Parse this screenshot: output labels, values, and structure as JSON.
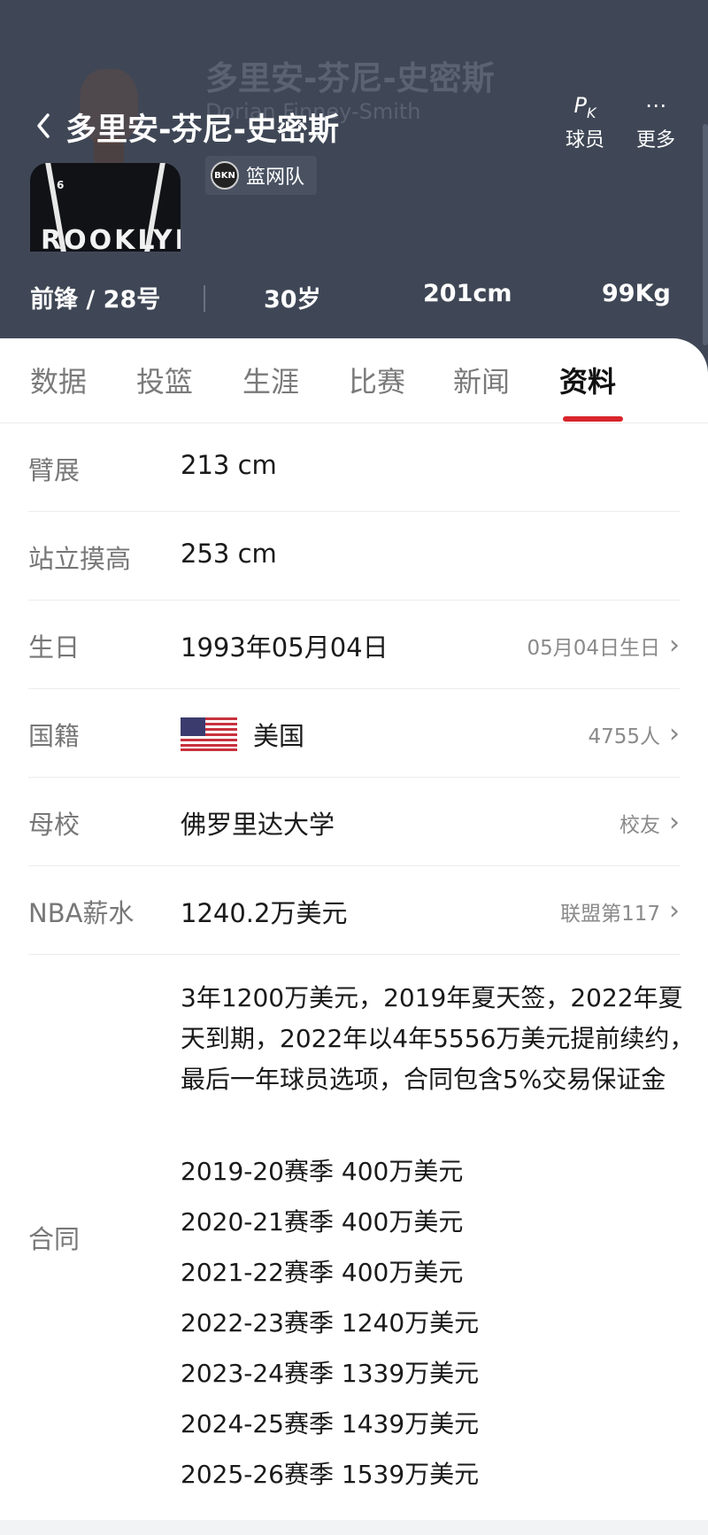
{
  "header": {
    "player_name": "多里安-芬尼-史密斯",
    "player_name_en": "Dorian Finney-Smith",
    "team_name": "篮网队",
    "team_logo_text": "BKN",
    "jersey_text": "ROOKLYN",
    "jersey_number": "6",
    "actions": [
      {
        "label": "球员",
        "icon": "pk-icon"
      },
      {
        "label": "更多",
        "icon": "more-icon"
      }
    ],
    "stats": {
      "position": "前锋 / 28号",
      "age": "30岁",
      "height": "201cm",
      "weight": "99Kg"
    },
    "background_color": "#3f4756"
  },
  "tabs": [
    {
      "label": "数据",
      "active": false
    },
    {
      "label": "投篮",
      "active": false
    },
    {
      "label": "生涯",
      "active": false
    },
    {
      "label": "比赛",
      "active": false
    },
    {
      "label": "新闻",
      "active": false
    },
    {
      "label": "资料",
      "active": true
    }
  ],
  "accent_color": "#d8252c",
  "profile": {
    "wingspan": {
      "label": "臂展",
      "value": "213 cm"
    },
    "standing_reach": {
      "label": "站立摸高",
      "value": "253 cm"
    },
    "birthday": {
      "label": "生日",
      "value": "1993年05月04日",
      "link": "05月04日生日"
    },
    "nationality": {
      "label": "国籍",
      "value": "美国",
      "link": "4755人",
      "flag": "us-flag"
    },
    "college": {
      "label": "母校",
      "value": "佛罗里达大学",
      "link": "校友"
    },
    "salary": {
      "label": "NBA薪水",
      "value": "1240.2万美元",
      "link": "联盟第117"
    },
    "contract": {
      "label": "合同",
      "description": "3年1200万美元，2019年夏天签，2022年夏天到期，2022年以4年5556万美元提前续约，最后一年球员选项，合同包含5%交易保证金",
      "seasons": [
        "2019-20赛季 400万美元",
        "2020-21赛季 400万美元",
        "2021-22赛季 400万美元",
        "2022-23赛季 1240万美元",
        "2023-24赛季 1339万美元",
        "2024-25赛季 1439万美元",
        "2025-26赛季 1539万美元"
      ]
    }
  }
}
